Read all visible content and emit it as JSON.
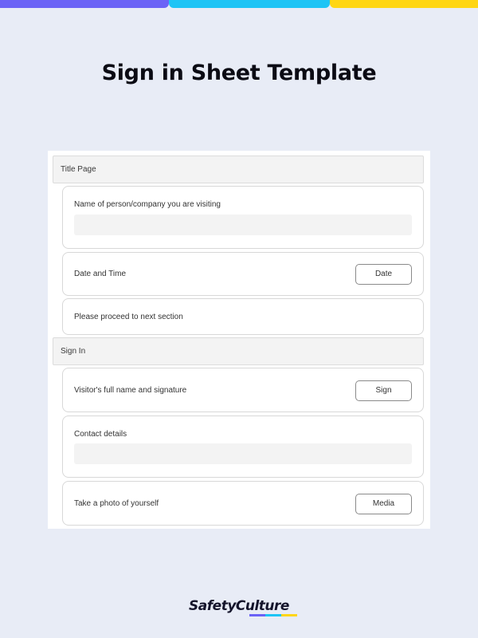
{
  "page": {
    "title": "Sign in Sheet Template",
    "accent_colors": [
      "#6b63f6",
      "#1ec4f5",
      "#ffd614"
    ],
    "background": "#e8ecf6"
  },
  "form": {
    "sections": [
      {
        "title": "Title Page",
        "questions": [
          {
            "label": "Name of person/company you are visiting",
            "type": "text"
          },
          {
            "label": "Date and Time",
            "type": "button",
            "button_label": "Date"
          },
          {
            "label": "Please proceed to next section",
            "type": "instruction"
          }
        ]
      },
      {
        "title": "Sign In",
        "questions": [
          {
            "label": "Visitor's full name and signature",
            "type": "button",
            "button_label": "Sign"
          },
          {
            "label": "Contact details",
            "type": "text"
          },
          {
            "label": "Take a photo of yourself",
            "type": "button",
            "button_label": "Media"
          }
        ]
      }
    ]
  },
  "brand": {
    "name": "SafetyCulture",
    "logo_label": "safetyculture-logo"
  }
}
